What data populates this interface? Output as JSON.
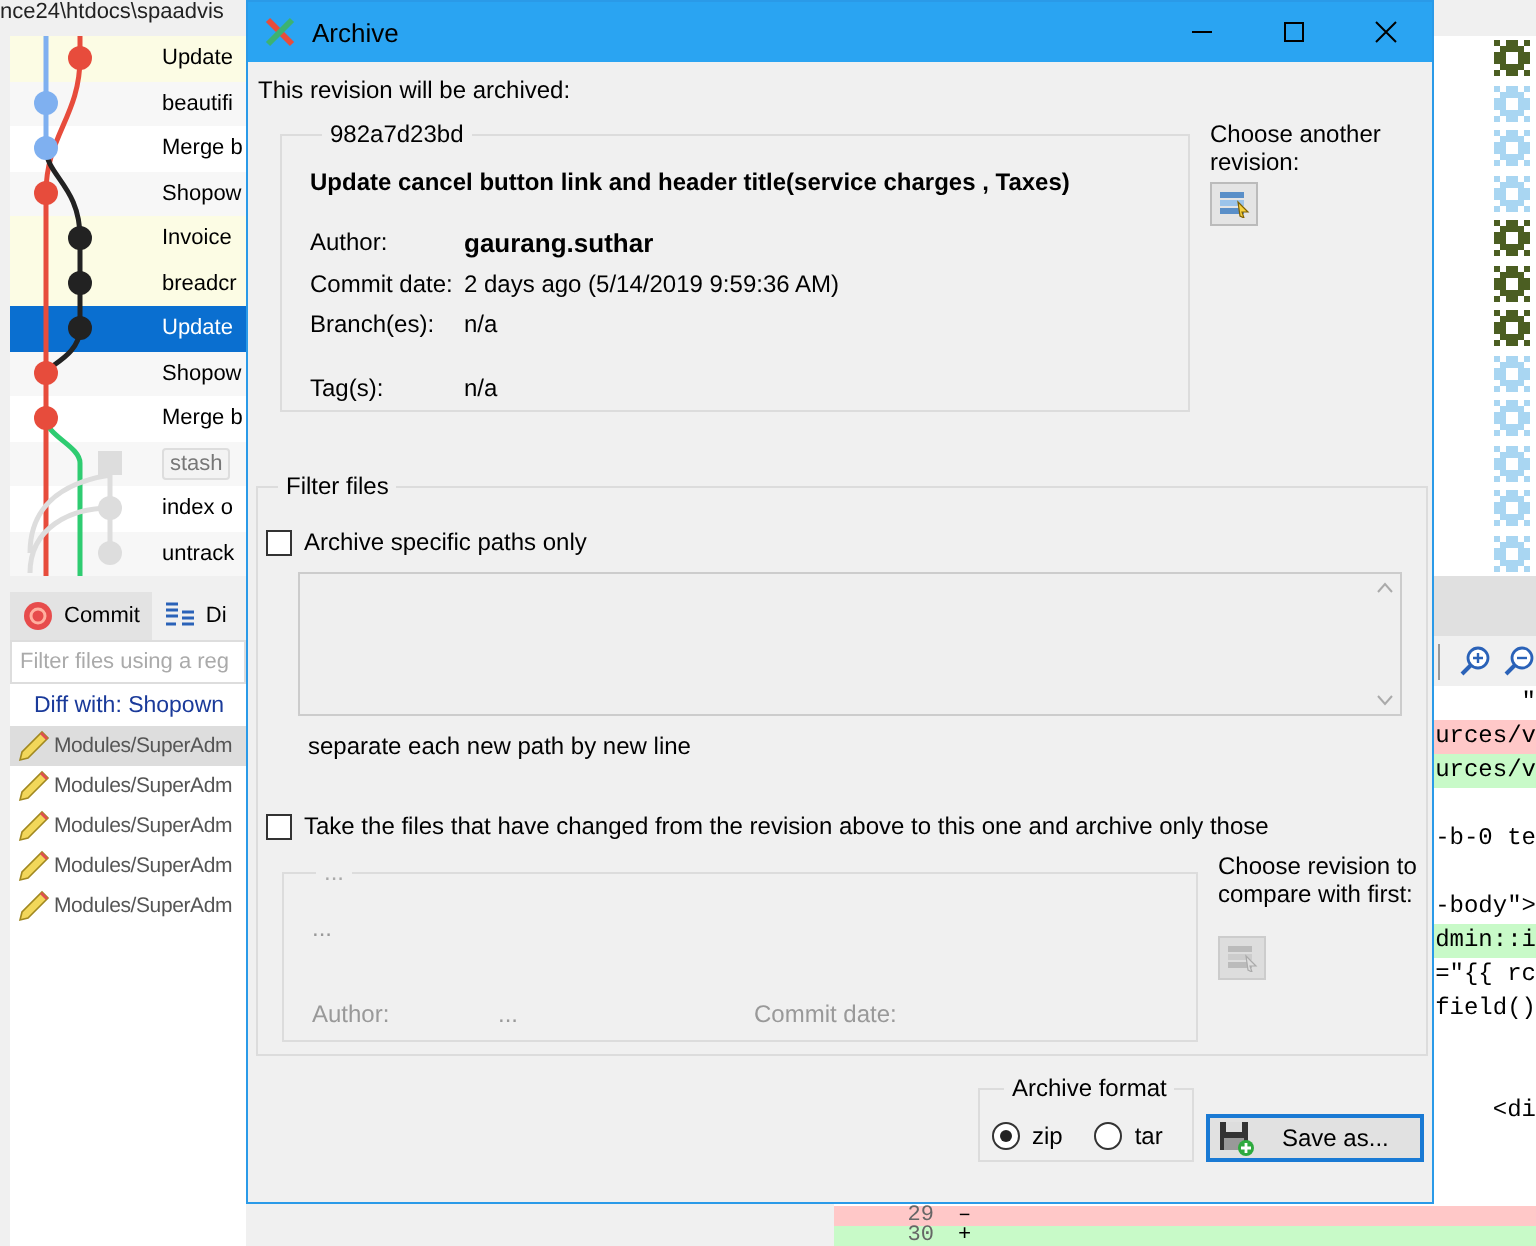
{
  "background": {
    "path_bar": "nce24\\htdocs\\spaadvis",
    "commits": [
      {
        "message": "Update",
        "highlighted": true,
        "selected": false,
        "color": "#4b5e22"
      },
      {
        "message": "beautifi",
        "highlighted": false,
        "selected": false,
        "color": "#a9d6f2"
      },
      {
        "message": "Merge b",
        "highlighted": false,
        "selected": false,
        "color": "#a9d6f2"
      },
      {
        "message": "Shopow",
        "highlighted": false,
        "selected": false,
        "color": "#a9d6f2"
      },
      {
        "message": "Invoice",
        "highlighted": true,
        "selected": false,
        "color": "#4b5e22"
      },
      {
        "message": "breadcr",
        "highlighted": true,
        "selected": false,
        "color": "#4b5e22"
      },
      {
        "message": "Update",
        "highlighted": false,
        "selected": true,
        "color": "#4b5e22"
      },
      {
        "message": "Shopow",
        "highlighted": false,
        "selected": false,
        "color": "#a9d6f2"
      },
      {
        "message": "Merge b",
        "highlighted": false,
        "selected": false,
        "color": "#a9d6f2"
      },
      {
        "badge": "stash",
        "highlighted": false,
        "selected": false,
        "color": "#a9d6f2"
      },
      {
        "message": "index o",
        "highlighted": false,
        "selected": false,
        "color": "#a9d6f2"
      },
      {
        "message": "untrack",
        "highlighted": false,
        "selected": false,
        "color": "#a9d6f2"
      }
    ],
    "commit_panel": {
      "tabs": [
        {
          "label": "Commit",
          "selected": true
        },
        {
          "label": "Di",
          "selected": false
        }
      ],
      "filter": {
        "placeholder": "Filter files using a reg"
      },
      "diff_header": "Diff with: Shopown",
      "files": [
        {
          "path": "Modules/SuperAdm",
          "selected": true
        },
        {
          "path": "Modules/SuperAdm",
          "selected": false
        },
        {
          "path": "Modules/SuperAdm",
          "selected": false
        },
        {
          "path": "Modules/SuperAdm",
          "selected": false
        },
        {
          "path": "Modules/SuperAdm",
          "selected": false
        }
      ]
    },
    "diff_view": {
      "lines": [
        {
          "text": "\"",
          "kind": "context"
        },
        {
          "text": "urces/v",
          "kind": "removed"
        },
        {
          "text": "urces/v",
          "kind": "added"
        },
        {
          "kind": "context"
        },
        {
          "text": "-b-0 te",
          "kind": "context"
        },
        {
          "kind": "context"
        },
        {
          "text": "-body\">",
          "kind": "context"
        },
        {
          "text": "dmin::i",
          "kind": "added"
        },
        {
          "text": "=\"{{ rc",
          "kind": "context"
        },
        {
          "text": "field()",
          "kind": "context"
        },
        {
          "kind": "context"
        },
        {
          "kind": "context"
        },
        {
          "text": "<di",
          "kind": "context"
        }
      ],
      "numbered_lines": [
        {
          "number": "29",
          "text": "–",
          "kind": "removed"
        },
        {
          "number": "30",
          "text": "+",
          "kind": "added"
        }
      ]
    }
  },
  "dialog": {
    "title": "Archive",
    "intro": "This revision will be archived:",
    "revision": {
      "hash": "982a7d23bd",
      "message": "Update cancel button link and header title(service charges , Taxes)",
      "fields": [
        {
          "label": "Author:",
          "value": "gaurang.suthar",
          "kind": "bold"
        },
        {
          "label": "Commit date:",
          "value": "2 days ago (5/14/2019 9:59:36 AM)",
          "kind": "plain"
        },
        {
          "label": "Branch(es):",
          "value": "n/a",
          "kind": "plain"
        },
        {
          "label": "Tag(s):",
          "value": "n/a",
          "kind": "spaced"
        }
      ]
    },
    "choose_revision": "Choose another revision:",
    "filter": {
      "title": "Filter files",
      "specific_paths": {
        "label": "Archive specific paths only",
        "checked": false
      },
      "paths_hint": "separate each new path by new line",
      "changed_files": {
        "label": "Take the files that have changed from the revision above to this one and archive only those",
        "checked": false
      },
      "compare": {
        "hash": "...",
        "message": "...",
        "author_label": "Author:",
        "author": "...",
        "date_label": "Commit date:",
        "disabled": true
      },
      "choose_compare": "Choose revision to compare with first:"
    },
    "archive_format": {
      "title": "Archive format",
      "options": [
        {
          "label": "zip",
          "selected": true
        },
        {
          "label": "tar",
          "selected": false
        }
      ]
    },
    "save_button": "Save as..."
  }
}
